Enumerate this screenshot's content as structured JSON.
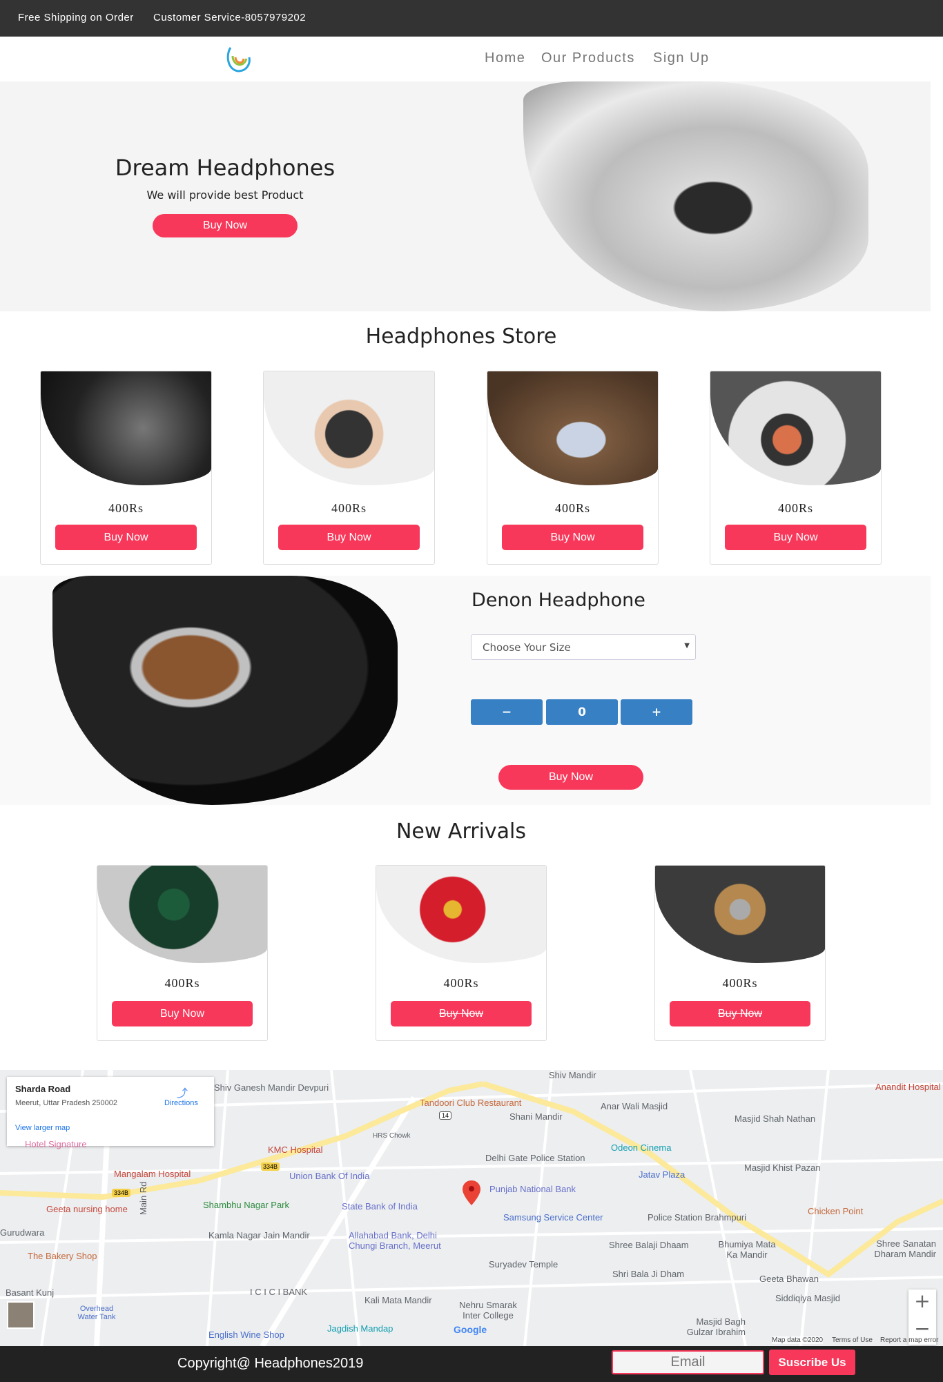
{
  "topbar": {
    "shipping": "Free Shipping on Order",
    "service": "Customer Service-8057979202"
  },
  "nav": {
    "links": [
      "Home",
      "Our Products",
      "Sign Up"
    ]
  },
  "hero": {
    "title": "Dream Headphones",
    "subtitle": "We will provide best Product",
    "button": "Buy Now"
  },
  "store": {
    "title": "Headphones Store",
    "products": [
      {
        "price": "400Rs",
        "button": "Buy Now"
      },
      {
        "price": "400Rs",
        "button": "Buy Now"
      },
      {
        "price": "400Rs",
        "button": "Buy Now"
      },
      {
        "price": "400Rs",
        "button": "Buy Now"
      }
    ]
  },
  "denon": {
    "title": "Denon Headphone",
    "select_placeholder": "Choose Your Size",
    "minus": "−",
    "quantity": "0",
    "plus": "+",
    "button": "Buy Now"
  },
  "arrivals": {
    "title": "New Arrivals",
    "products": [
      {
        "price": "400Rs",
        "button": "Buy Now"
      },
      {
        "price": "400Rs",
        "button": "Buy Now"
      },
      {
        "price": "400Rs",
        "button": "Buy Now"
      }
    ]
  },
  "map": {
    "place_name": "Sharda Road",
    "address": "Meerut, Uttar Pradesh 250002",
    "directions": "Directions",
    "larger_map": "View larger map",
    "labels": [
      "Shiv Ganesh Mandir Devpuri",
      "Tandoori Club Restaurant",
      "Shiv Mandir",
      "Anar Wali Masjid",
      "Shani Mandir",
      "Hotel Signature",
      "KMC Hospital",
      "HRS Chowk",
      "Odeon Cinema",
      "Masjid Shah Nathan",
      "Anandit Hospital",
      "Delhi Gate Police Station",
      "Jatav Plaza",
      "Masjid Khist Pazan",
      "Mangalam Hospital",
      "Union Bank Of India",
      "Punjab National Bank",
      "Shambhu Nagar Park",
      "State Bank of India",
      "Samsung Service Center",
      "Police Station Brahmpuri",
      "Chicken Point",
      "Geeta nursing home",
      "Gurudwara",
      "Kamla Nagar Jain Mandir",
      "Allahabad Bank, Delhi Chungi Branch, Meerut",
      "Shree Balaji Dhaam",
      "Bhumiya Mata Ka Mandir",
      "Shree Sanatan Dharam Mandir",
      "The Bakery Shop",
      "Suryadev Temple",
      "Shri Bala Ji Dham",
      "Geeta Bhawan",
      "Basant Kunj",
      "I C I C I BANK",
      "Kali Mata Mandir",
      "Nehru Smarak Inter College",
      "Siddiqiya Masjid",
      "Overhead Water Tank",
      "English Wine Shop",
      "Jagdish Mandap",
      "Masjid Bagh Gulzar Ibrahim",
      "Main Rd"
    ],
    "road_badges": [
      "334B",
      "334B",
      "14"
    ],
    "zoom_in": "+",
    "zoom_out": "−",
    "attribution": [
      "Map data ©2020",
      "Terms of Use",
      "Report a map error"
    ],
    "google": "Google"
  },
  "footer": {
    "copyright": "Copyright@ Headphones2019",
    "email_placeholder": "Email",
    "subscribe": "Suscribe Us"
  }
}
